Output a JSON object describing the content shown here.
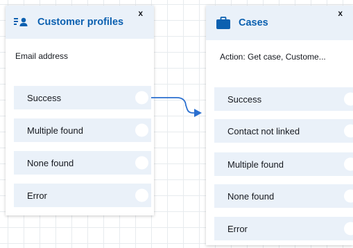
{
  "customer_profiles_block": {
    "title": "Customer profiles",
    "icon": "customer-profile-icon",
    "close_label": "x",
    "parameter": "Email address",
    "branches": [
      "Success",
      "Multiple found",
      "None found",
      "Error"
    ]
  },
  "cases_block": {
    "title": "Cases",
    "icon": "briefcase-icon",
    "close_label": "x",
    "parameter": "Action: Get case, Custome...",
    "branches": [
      "Success",
      "Contact not linked",
      "Multiple found",
      "None found",
      "Error"
    ]
  },
  "colors": {
    "accent": "#0b60b0",
    "connector": "#2a6fcf",
    "header_bg": "#eaf1f9",
    "grid": "#e7ebee"
  }
}
